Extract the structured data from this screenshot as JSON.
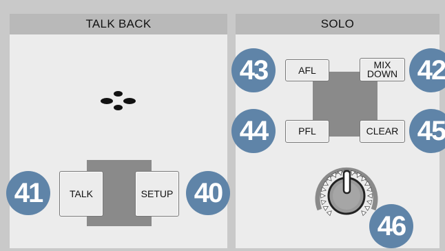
{
  "talkback": {
    "title": "TALK BACK",
    "talk_label": "TALK",
    "setup_label": "SETUP",
    "badge_talk": "41",
    "badge_setup": "40"
  },
  "solo": {
    "title": "SOLO",
    "afl_label": "AFL",
    "mixdown_line1": "MIX",
    "mixdown_line2": "DOWN",
    "pfl_label": "PFL",
    "clear_label": "CLEAR",
    "badge_afl": "43",
    "badge_mixdown": "42",
    "badge_pfl": "44",
    "badge_clear": "45",
    "badge_knob": "46"
  },
  "colors": {
    "badge": "#5f84a8",
    "panel": "#ececec",
    "header": "#b9b9b9",
    "block": "#8a8a8a"
  },
  "icons": [
    "microphone-icon",
    "solo-level-knob"
  ]
}
